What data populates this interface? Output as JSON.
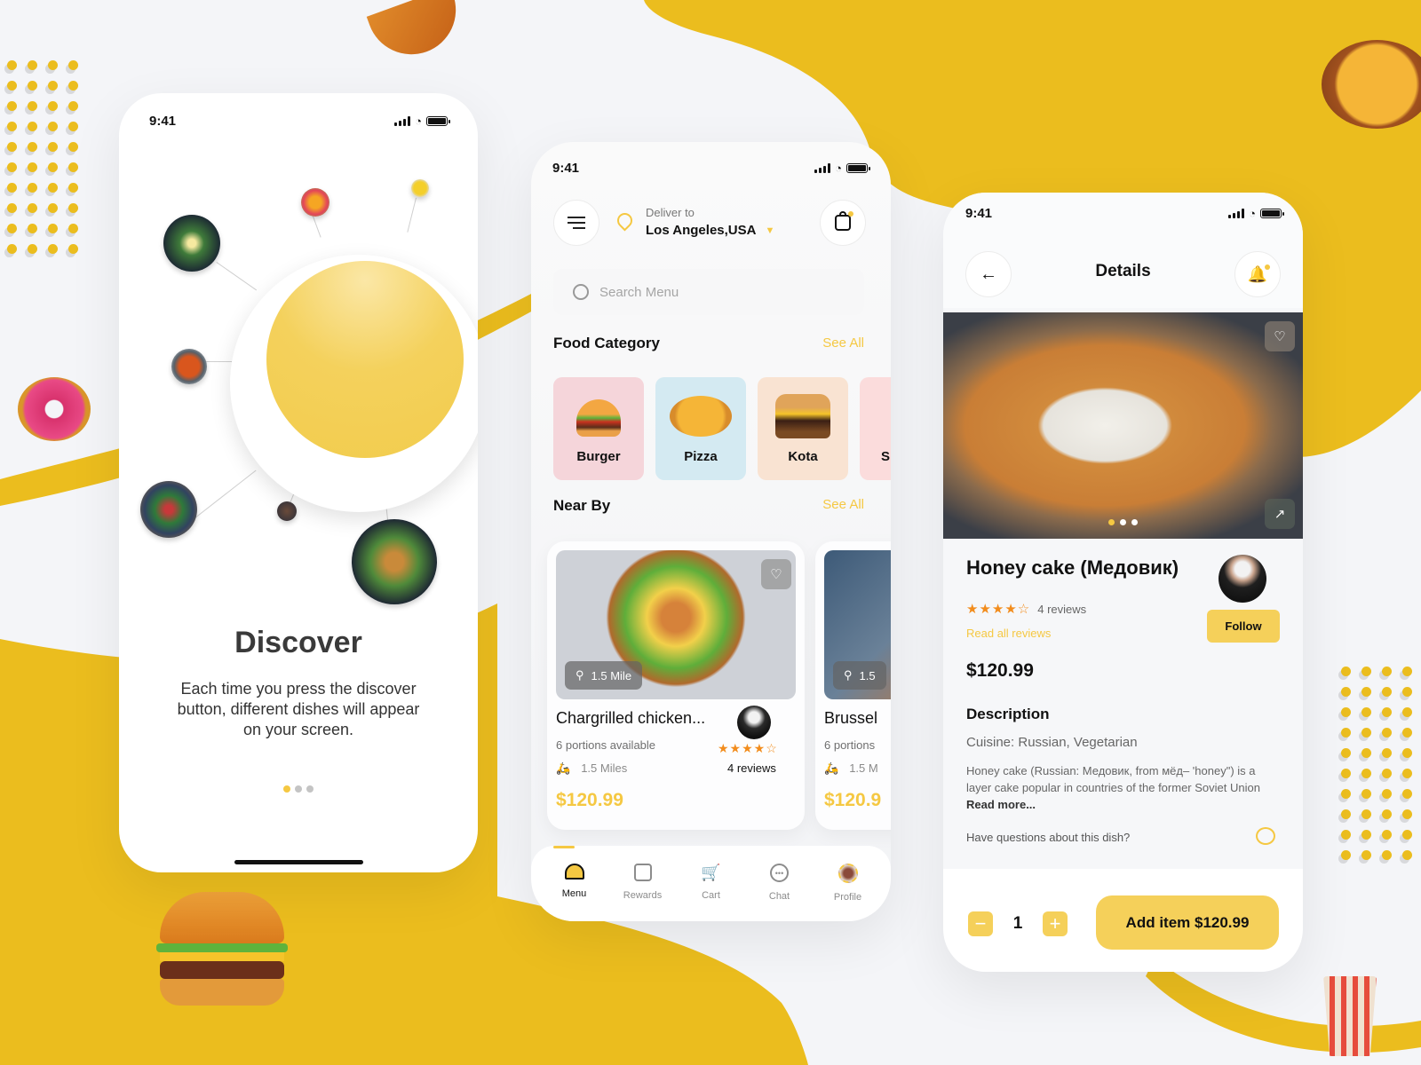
{
  "colors": {
    "accent": "#f5c842",
    "bg_yellow": "#ebbd1e",
    "star": "#f28c1c",
    "text": "#111111",
    "muted": "#8c8c8c"
  },
  "phone1": {
    "status": {
      "time": "9:41"
    },
    "title": "Discover",
    "body": "Each time you press the discover button, different dishes will appear on your screen.",
    "pager": {
      "total": 3,
      "active": 1
    }
  },
  "phone2": {
    "status": {
      "time": "9:41"
    },
    "header": {
      "menu_icon": "menu-icon",
      "deliver_label": "Deliver to",
      "location": "Los Angeles,USA",
      "bag_icon": "shopping-bag-icon"
    },
    "search": {
      "placeholder": "Search Menu"
    },
    "food_category": {
      "title": "Food Category",
      "see_all": "See All",
      "items": [
        {
          "label": "Burger",
          "bg": "#f5d5da"
        },
        {
          "label": "Pizza",
          "bg": "#d4eaf2"
        },
        {
          "label": "Kota",
          "bg": "#f9e3d2"
        },
        {
          "label": "S",
          "bg": "#fbdcdc"
        }
      ]
    },
    "near_by": {
      "title": "Near By",
      "see_all": "See All",
      "cards": [
        {
          "distance_badge": "1.5 Mile",
          "name": "Chargrilled chicken...",
          "portions": "6 portions available",
          "miles": "1.5 Miles",
          "rating": 4,
          "reviews": "4 reviews",
          "price": "$120.99"
        },
        {
          "distance_badge": "1.5",
          "name": "Brussel",
          "portions": "6 portions",
          "miles": "1.5 M",
          "price": "$120.9"
        }
      ]
    },
    "tabbar": [
      {
        "label": "Menu",
        "icon": "cloche-icon",
        "active": true
      },
      {
        "label": "Rewards",
        "icon": "gift-icon",
        "active": false
      },
      {
        "label": "Cart",
        "icon": "cart-icon",
        "active": false
      },
      {
        "label": "Chat",
        "icon": "chat-icon",
        "active": false
      },
      {
        "label": "Profile",
        "icon": "avatar-icon",
        "active": false
      }
    ]
  },
  "phone3": {
    "status": {
      "time": "9:41"
    },
    "header": {
      "title": "Details",
      "back_icon": "arrow-left-icon",
      "bell_icon": "bell-icon"
    },
    "gallery": {
      "total": 3,
      "active": 1
    },
    "dish": {
      "name": "Honey cake (Медовик)",
      "rating": 4,
      "reviews": "4 reviews",
      "read_all": "Read all reviews",
      "follow": "Follow",
      "price": "$120.99"
    },
    "description": {
      "title": "Description",
      "cuisine": "Cuisine: Russian, Vegetarian",
      "text": "Honey cake (Russian: Медовик, from мёд– 'honey\") is a layer cake popular in countries of the former Soviet Union ",
      "read_more": "Read more...",
      "question": "Have questions about this dish?"
    },
    "order": {
      "quantity": "1",
      "add_label": "Add item $120.99"
    }
  }
}
